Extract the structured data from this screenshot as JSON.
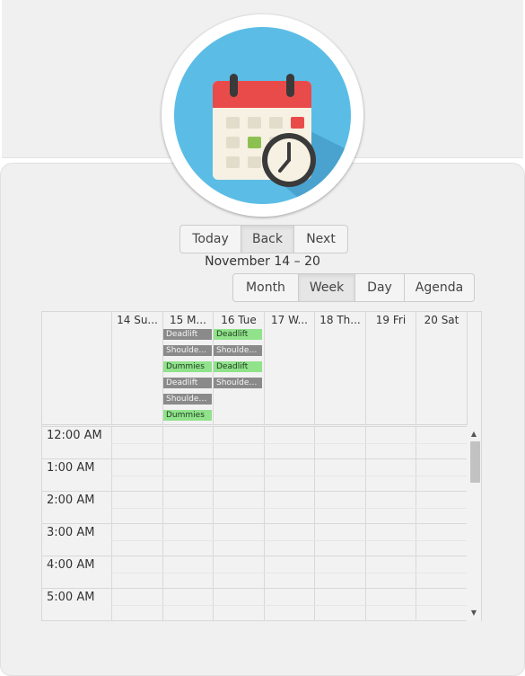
{
  "toolbar": {
    "today_label": "Today",
    "back_label": "Back",
    "next_label": "Next",
    "date_range": "November 14 – 20",
    "views": [
      {
        "label": "Month",
        "active": false
      },
      {
        "label": "Week",
        "active": true
      },
      {
        "label": "Day",
        "active": false
      },
      {
        "label": "Agenda",
        "active": false
      }
    ]
  },
  "week": {
    "day_headers": [
      "14 Su...",
      "15 M...",
      "16 Tue",
      "17 W...",
      "18 Th...",
      "19 Fri",
      "20 Sat"
    ],
    "all_day_events": [
      {
        "day_index": 1,
        "slot": 0,
        "title": "Deadlift",
        "color": "gray"
      },
      {
        "day_index": 1,
        "slot": 1,
        "title": "Shoulder ...",
        "color": "gray"
      },
      {
        "day_index": 1,
        "slot": 2,
        "title": "Dummies",
        "color": "green"
      },
      {
        "day_index": 1,
        "slot": 3,
        "title": "Deadlift",
        "color": "gray"
      },
      {
        "day_index": 1,
        "slot": 4,
        "title": "Shoulder ...",
        "color": "gray"
      },
      {
        "day_index": 1,
        "slot": 5,
        "title": "Dummies",
        "color": "green"
      },
      {
        "day_index": 2,
        "slot": 0,
        "title": "Deadlift",
        "color": "green"
      },
      {
        "day_index": 2,
        "slot": 1,
        "title": "Shoulder ...",
        "color": "gray"
      },
      {
        "day_index": 2,
        "slot": 2,
        "title": "Deadlift",
        "color": "green"
      },
      {
        "day_index": 2,
        "slot": 3,
        "title": "Shoulder ...",
        "color": "gray"
      }
    ],
    "time_slots": [
      "12:00 AM",
      "1:00 AM",
      "2:00 AM",
      "3:00 AM",
      "4:00 AM",
      "5:00 AM"
    ]
  },
  "colors": {
    "event_gray": "#8a8a8a",
    "event_green": "#90e28b",
    "logo_bg": "#5bbde6",
    "calendar_header_red": "#e94b4b"
  },
  "icons": {
    "logo": "calendar-clock-icon",
    "scroll_up": "triangle-up-icon",
    "scroll_down": "triangle-down-icon"
  }
}
